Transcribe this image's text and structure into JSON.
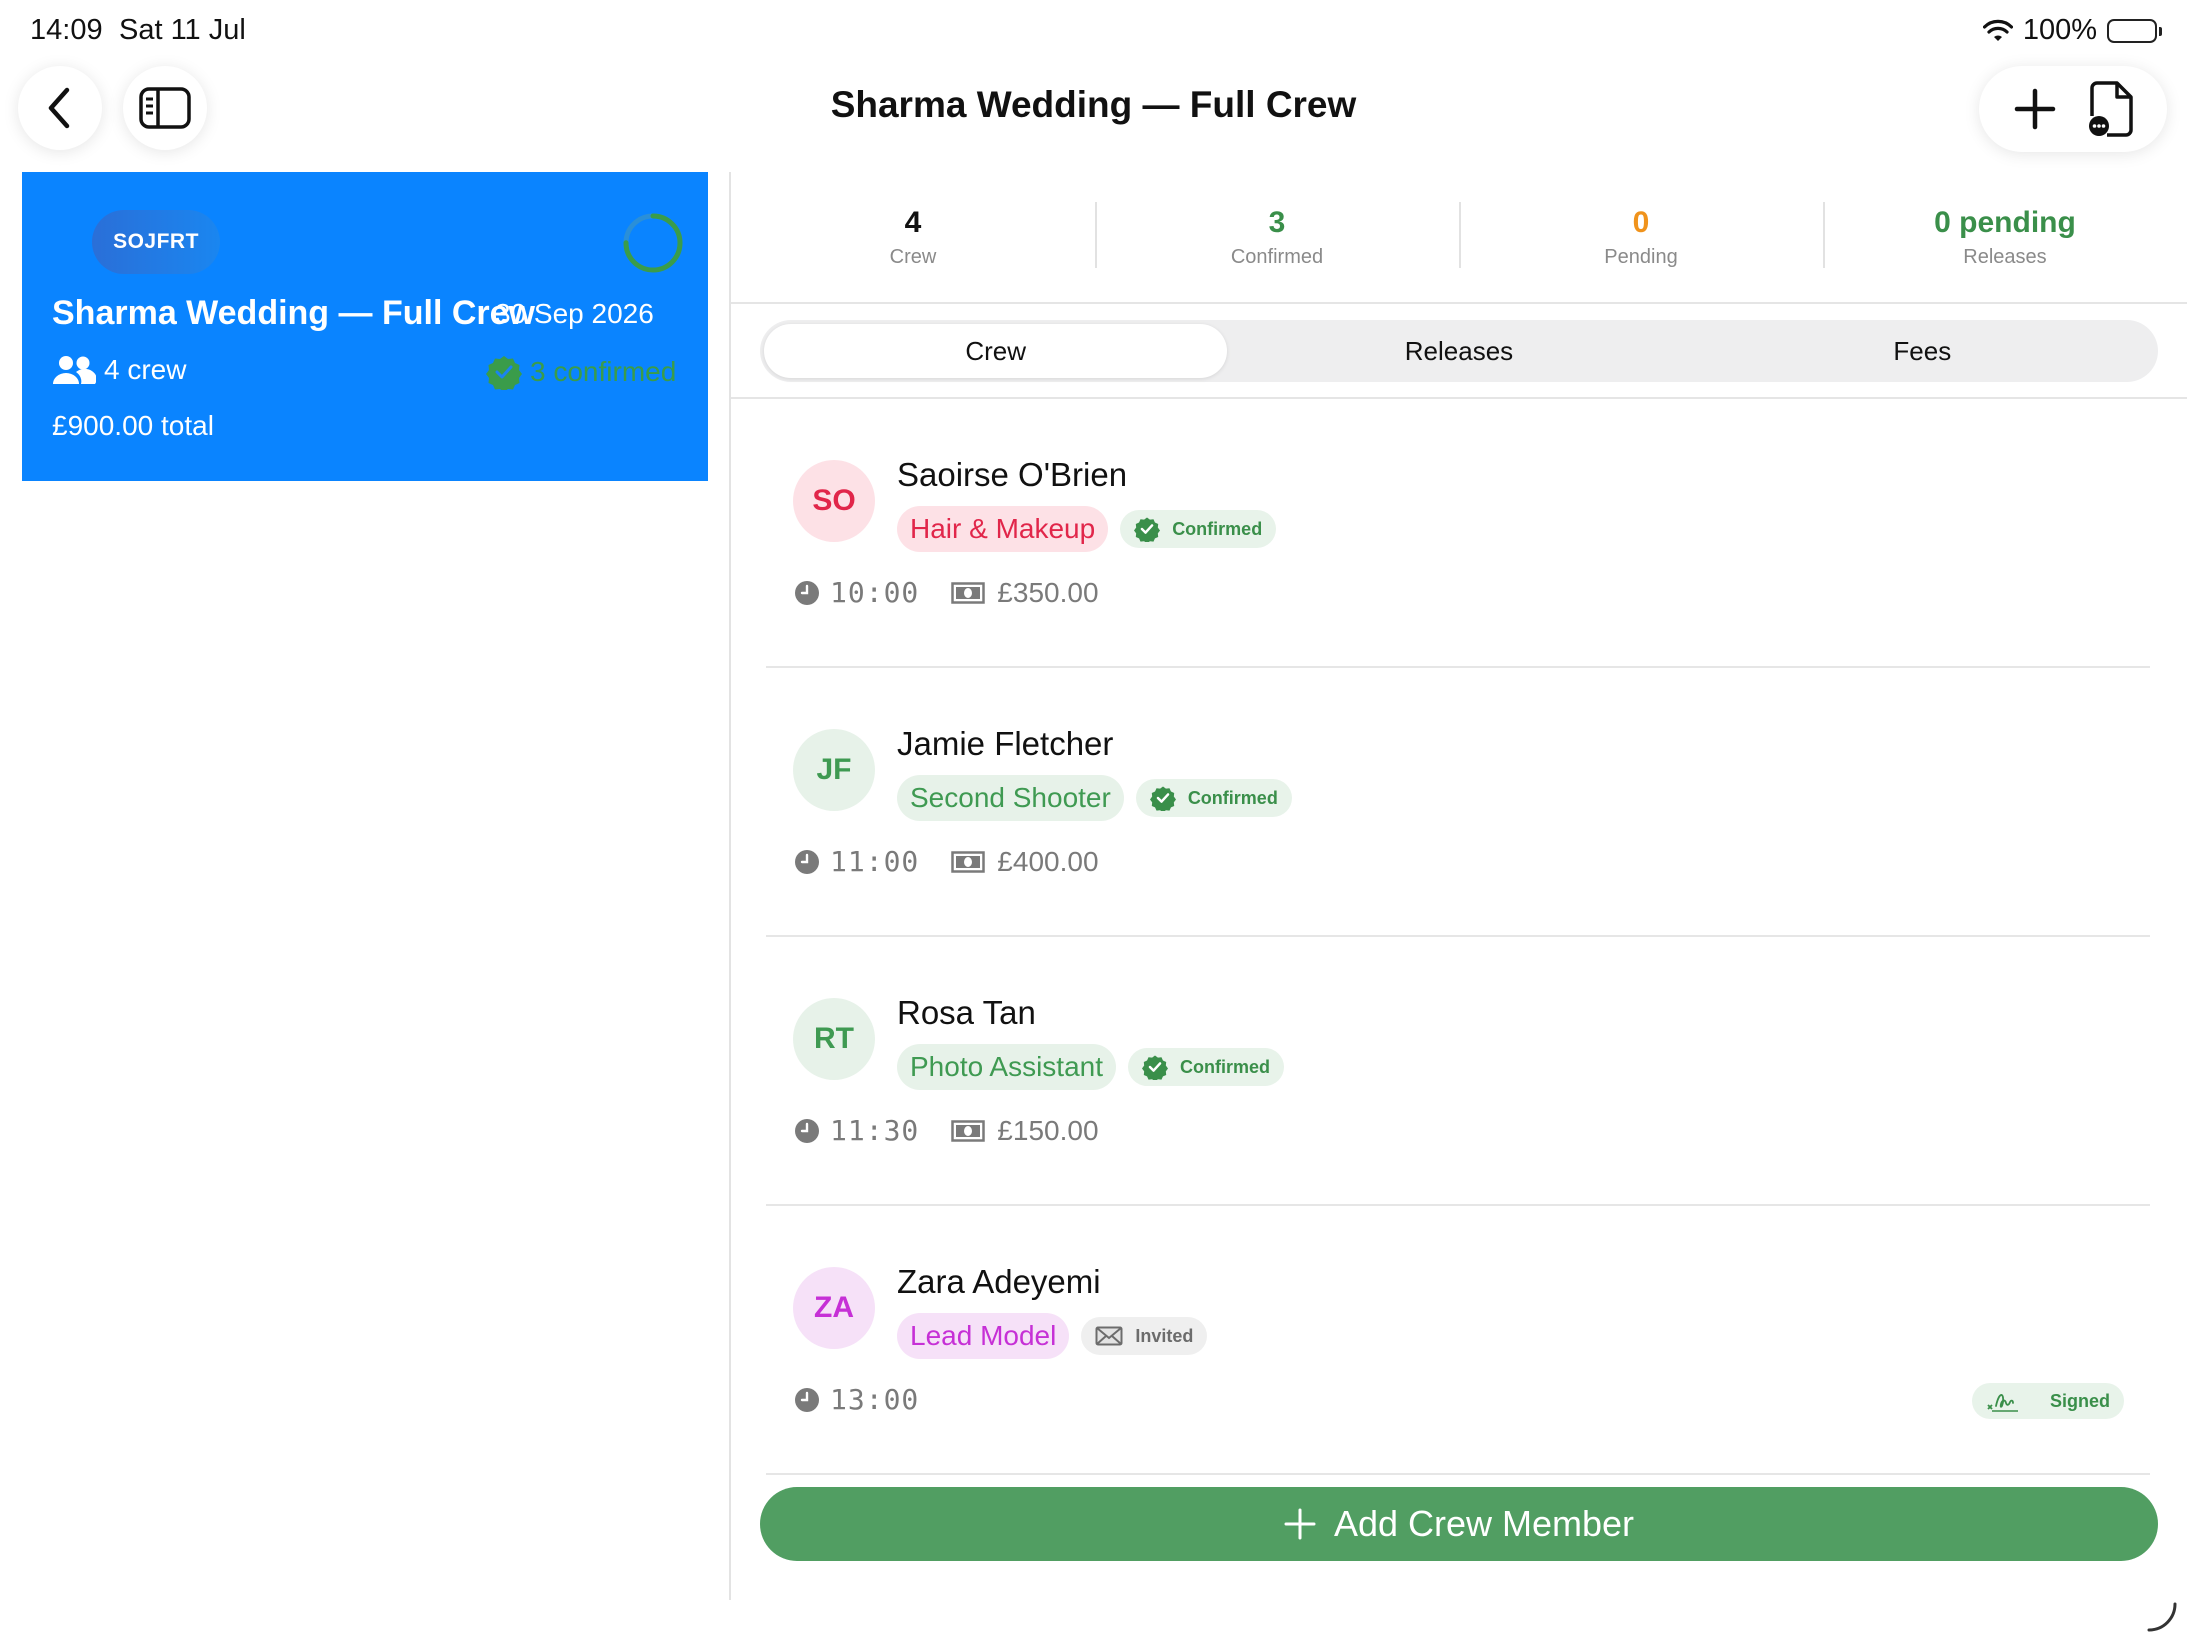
{
  "status_bar": {
    "time": "14:09",
    "date": "Sat 11 Jul",
    "battery": "100%"
  },
  "nav": {
    "title": "Sharma Wedding — Full Crew"
  },
  "sidebar": {
    "event": {
      "initials": "SOJFRT",
      "title": "Sharma Wedding — Full Crew",
      "date": "30 Sep 2026",
      "crew": "4 crew",
      "confirmed": "3 confirmed",
      "total": "£900.00 total",
      "progress": 0.75
    }
  },
  "stats": [
    {
      "value": "4",
      "label": "Crew",
      "color": "#111111"
    },
    {
      "value": "3",
      "label": "Confirmed",
      "color": "#3a8f4a"
    },
    {
      "value": "0",
      "label": "Pending",
      "color": "#f0931c"
    },
    {
      "value": "0 pending",
      "label": "Releases",
      "color": "#3a8f4a"
    }
  ],
  "tabs": [
    {
      "label": "Crew",
      "active": true
    },
    {
      "label": "Releases",
      "active": false
    },
    {
      "label": "Fees",
      "active": false
    }
  ],
  "crew": [
    {
      "initials": "SO",
      "name": "Saoirse O'Brien",
      "role": "Hair & Makeup",
      "status": "Confirmed",
      "time": "10:00",
      "fee": "£350.00",
      "avatar_bg": "#fde1e6",
      "avatar_fg": "#e1264a",
      "role_bg": "#fde1e6",
      "role_fg": "#e1264a"
    },
    {
      "initials": "JF",
      "name": "Jamie Fletcher",
      "role": "Second Shooter",
      "status": "Confirmed",
      "time": "11:00",
      "fee": "£400.00",
      "avatar_bg": "#e7f2e9",
      "avatar_fg": "#3f9a52",
      "role_bg": "#e7f2e9",
      "role_fg": "#3f9a52"
    },
    {
      "initials": "RT",
      "name": "Rosa Tan",
      "role": "Photo Assistant",
      "status": "Confirmed",
      "time": "11:30",
      "fee": "£150.00",
      "avatar_bg": "#e7f2e9",
      "avatar_fg": "#3f9a52",
      "role_bg": "#e7f2e9",
      "role_fg": "#3f9a52"
    },
    {
      "initials": "ZA",
      "name": "Zara Adeyemi",
      "role": "Lead Model",
      "status": "Invited",
      "time": "13:00",
      "release": "Signed",
      "avatar_bg": "#f6e1f8",
      "avatar_fg": "#c630d6",
      "role_bg": "#f6e1f8",
      "role_fg": "#c630d6"
    }
  ],
  "add_button": {
    "label": "Add Crew Member"
  },
  "icons": {
    "back": "chevron-left-icon",
    "sidebar": "sidebar-toggle-icon",
    "add": "plus-icon",
    "document": "document-more-icon",
    "crew": "people-icon",
    "confirmed": "verified-badge-icon",
    "invited": "envelope-icon",
    "time": "clock-icon",
    "fee": "banknote-icon",
    "signed": "signature-icon"
  },
  "colors": {
    "accent_blue": "#0a84ff",
    "green": "#519e62",
    "orange": "#f0931c"
  }
}
